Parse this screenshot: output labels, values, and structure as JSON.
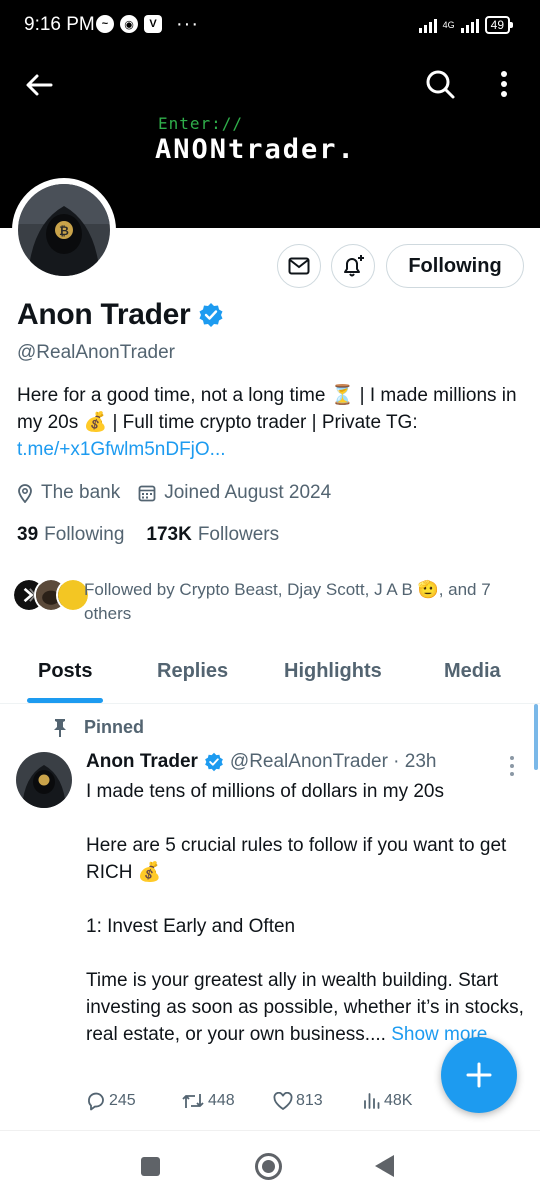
{
  "status_bar": {
    "time": "9:16 PM",
    "app_icons": [
      "messenger-icon",
      "chrome-icon",
      "vivaldi-icon"
    ],
    "overflow": "···",
    "network": "4G",
    "battery": "49"
  },
  "banner": {
    "line1": "Enter://",
    "line2": "ANONtrader."
  },
  "profile": {
    "name": "Anon Trader",
    "handle": "@RealAnonTrader",
    "bio_text": "Here for a good time, not a long time ⏳ | I made millions in my 20s 💰 | Full time crypto trader | Private TG: ",
    "bio_link": "t.me/+x1Gfwlm5nDFjO...",
    "location": "The bank",
    "joined": "Joined August 2024",
    "following_count": "39",
    "following_label": "Following",
    "followers_count": "173K",
    "followers_label": "Followers",
    "followed_by": "Followed by Crypto Beast, Djay Scott, J A B 🫡, and 7 others"
  },
  "actions": {
    "following_button": "Following"
  },
  "tabs": [
    {
      "label": "Posts",
      "active": true
    },
    {
      "label": "Replies",
      "active": false
    },
    {
      "label": "Highlights",
      "active": false
    },
    {
      "label": "Media",
      "active": false
    }
  ],
  "post": {
    "pinned_label": "Pinned",
    "author": "Anon Trader",
    "handle_time": "@RealAnonTrader · 23h",
    "p1": "I made tens of millions of dollars in my 20s",
    "p2": "Here are 5 crucial rules to follow if you want to get RICH 💰",
    "p3": "1: Invest Early and Often",
    "p4": "Time is your greatest ally in wealth building. Start investing as soon as possible, whether it’s in stocks, real estate, or your own business....",
    "show_more": "Show more",
    "replies": "245",
    "reposts": "448",
    "likes": "813",
    "views": "48K"
  },
  "colors": {
    "accent": "#1d9bf0",
    "text_primary": "#0f1419",
    "text_secondary": "#536471",
    "banner_green": "#2fae4a"
  }
}
